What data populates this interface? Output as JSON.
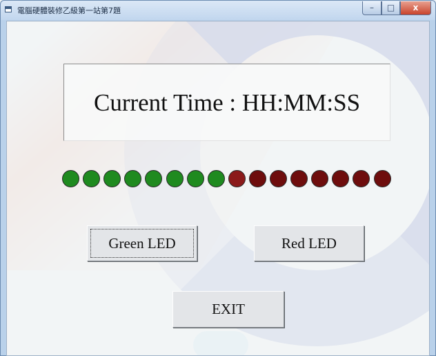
{
  "window": {
    "title": "電腦硬體裝修乙級第一站第7題",
    "controls": {
      "minimize_glyph": "–",
      "maximize_glyph": "□",
      "close_glyph": "x"
    }
  },
  "display": {
    "time_text": "Current Time : HH:MM:SS"
  },
  "leds": [
    {
      "state": "green",
      "color": "#1f8a1f"
    },
    {
      "state": "green",
      "color": "#1f8a1f"
    },
    {
      "state": "green",
      "color": "#1f8a1f"
    },
    {
      "state": "green",
      "color": "#1f8a1f"
    },
    {
      "state": "green",
      "color": "#1f8a1f"
    },
    {
      "state": "green",
      "color": "#1f8a1f"
    },
    {
      "state": "green",
      "color": "#1f8a1f"
    },
    {
      "state": "green",
      "color": "#1f8a1f"
    },
    {
      "state": "red",
      "color": "#8b1a1a"
    },
    {
      "state": "red",
      "color": "#6e0d0d"
    },
    {
      "state": "red",
      "color": "#6e0d0d"
    },
    {
      "state": "red",
      "color": "#6e0d0d"
    },
    {
      "state": "red",
      "color": "#6e0d0d"
    },
    {
      "state": "red",
      "color": "#6e0d0d"
    },
    {
      "state": "red",
      "color": "#6e0d0d"
    },
    {
      "state": "red",
      "color": "#6e0d0d"
    }
  ],
  "buttons": {
    "green_led": "Green LED",
    "red_led": "Red LED",
    "exit": "EXIT"
  }
}
